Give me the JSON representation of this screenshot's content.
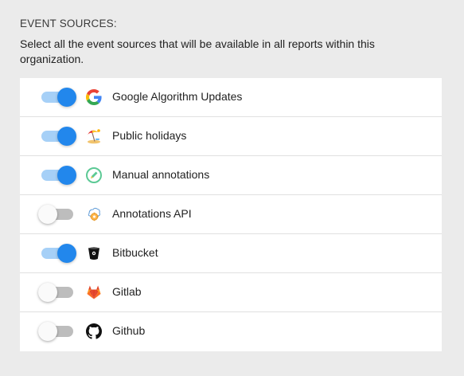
{
  "header": {
    "title": "EVENT SOURCES:",
    "description": "Select all the event sources that will be available in all reports within this organization."
  },
  "accent_color": "#2287ec",
  "sources": [
    {
      "label": "Google Algorithm Updates",
      "enabled": true,
      "icon": "google-icon"
    },
    {
      "label": "Public holidays",
      "enabled": true,
      "icon": "beach-umbrella-icon"
    },
    {
      "label": "Manual annotations",
      "enabled": true,
      "icon": "pencil-icon"
    },
    {
      "label": "Annotations API",
      "enabled": false,
      "icon": "api-gear-icon"
    },
    {
      "label": "Bitbucket",
      "enabled": true,
      "icon": "bitbucket-icon"
    },
    {
      "label": "Gitlab",
      "enabled": false,
      "icon": "gitlab-icon"
    },
    {
      "label": "Github",
      "enabled": false,
      "icon": "github-icon"
    }
  ]
}
